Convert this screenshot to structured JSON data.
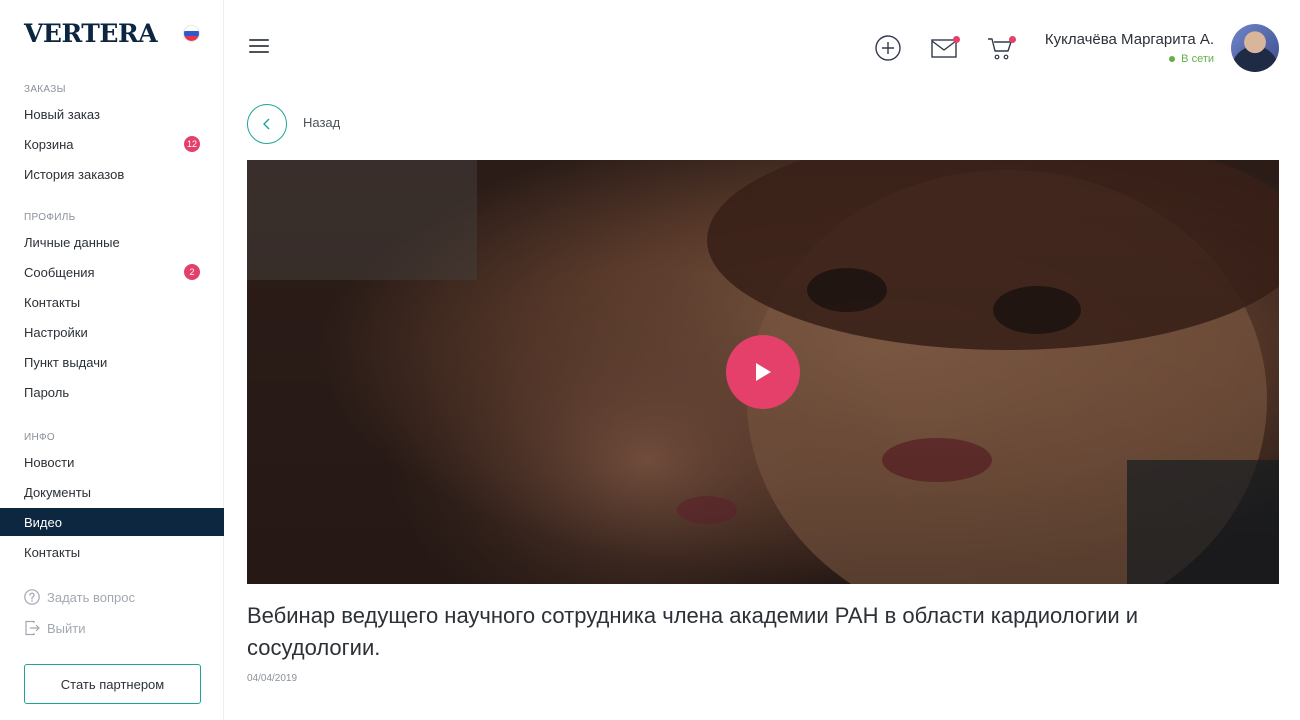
{
  "brand": {
    "logo": "VERTERA",
    "language_flag": "ru-flag-icon"
  },
  "sidebar": {
    "sections": [
      {
        "title": "ЗАКАЗЫ",
        "items": [
          {
            "label": "Новый заказ"
          },
          {
            "label": "Корзина",
            "badge": "12"
          },
          {
            "label": "История заказов"
          }
        ]
      },
      {
        "title": "ПРОФИЛЬ",
        "items": [
          {
            "label": "Личные данные"
          },
          {
            "label": "Сообщения",
            "badge": "2"
          },
          {
            "label": "Контакты"
          },
          {
            "label": "Настройки"
          },
          {
            "label": "Пункт выдачи"
          },
          {
            "label": "Пароль"
          }
        ]
      },
      {
        "title": "ИНФО",
        "items": [
          {
            "label": "Новости"
          },
          {
            "label": "Документы"
          },
          {
            "label": "Видео",
            "active": true
          },
          {
            "label": "Контакты"
          }
        ]
      }
    ],
    "ask_question": "Задать вопрос",
    "logout": "Выйти",
    "partner_button": "Стать партнером"
  },
  "header": {
    "icons": [
      "menu-icon",
      "add-icon",
      "mail-icon",
      "cart-icon"
    ],
    "user_name": "Куклачёва Маргарита А.",
    "user_status": "В сети"
  },
  "page": {
    "back_label": "Назад",
    "video_title": "Вебинар ведущего научного сотрудника члена академии РАН в области кардиологии и сосудологии.",
    "video_date": "04/04/2019"
  },
  "colors": {
    "brand_dark": "#0d2740",
    "accent_teal": "#1ea596",
    "accent_pink": "#e5406a",
    "online_green": "#63b04a"
  }
}
